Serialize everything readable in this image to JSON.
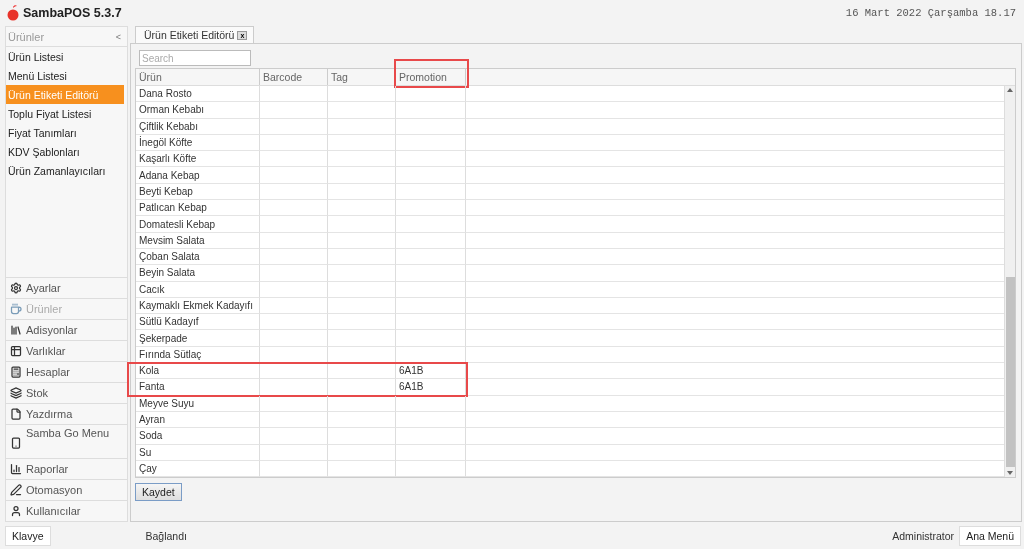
{
  "app": {
    "title": "SambaPOS 5.3.7",
    "datetime": "16 Mart 2022 Çarşamba 18.17"
  },
  "sidebar": {
    "title": "Ürünler",
    "collapse": "<",
    "items": [
      {
        "label": "Ürün Listesi",
        "selected": false
      },
      {
        "label": "Menü Listesi",
        "selected": false
      },
      {
        "label": "Ürün Etiketi Editörü",
        "selected": true
      },
      {
        "label": "Toplu Fiyat Listesi",
        "selected": false
      },
      {
        "label": "Fiyat Tanımları",
        "selected": false
      },
      {
        "label": "KDV Şablonları",
        "selected": false
      },
      {
        "label": "Ürün Zamanlayıcıları",
        "selected": false
      }
    ],
    "nav": [
      {
        "label": "Ayarlar",
        "selected": false
      },
      {
        "label": "Ürünler",
        "selected": true
      },
      {
        "label": "Adisyonlar",
        "selected": false
      },
      {
        "label": "Varlıklar",
        "selected": false
      },
      {
        "label": "Hesaplar",
        "selected": false
      },
      {
        "label": "Stok",
        "selected": false
      },
      {
        "label": "Yazdırma",
        "selected": false
      },
      {
        "label": "Samba Go Menu",
        "selected": false
      },
      {
        "label": "Raporlar",
        "selected": false
      },
      {
        "label": "Otomasyon",
        "selected": false
      },
      {
        "label": "Kullanıcılar",
        "selected": false
      }
    ]
  },
  "tab": {
    "label": "Ürün Etiketi Editörü",
    "close": "x"
  },
  "search": {
    "placeholder": "Search"
  },
  "table": {
    "columns": [
      {
        "label": "Ürün",
        "highlighted": false
      },
      {
        "label": "Barcode",
        "highlighted": false
      },
      {
        "label": "Tag",
        "highlighted": false
      },
      {
        "label": "Promotion",
        "highlighted": true
      }
    ],
    "rows": [
      {
        "name": "Dana Rosto",
        "promotion": "",
        "highlighted": false
      },
      {
        "name": "Orman Kebabı",
        "promotion": "",
        "highlighted": false
      },
      {
        "name": "Çiftlik Kebabı",
        "promotion": "",
        "highlighted": false
      },
      {
        "name": "İnegöl Köfte",
        "promotion": "",
        "highlighted": false
      },
      {
        "name": "Kaşarlı Köfte",
        "promotion": "",
        "highlighted": false
      },
      {
        "name": "Adana Kebap",
        "promotion": "",
        "highlighted": false
      },
      {
        "name": "Beyti Kebap",
        "promotion": "",
        "highlighted": false
      },
      {
        "name": "Patlıcan Kebap",
        "promotion": "",
        "highlighted": false
      },
      {
        "name": "Domatesli Kebap",
        "promotion": "",
        "highlighted": false
      },
      {
        "name": "Mevsim Salata",
        "promotion": "",
        "highlighted": false
      },
      {
        "name": "Çoban Salata",
        "promotion": "",
        "highlighted": false
      },
      {
        "name": "Beyin Salata",
        "promotion": "",
        "highlighted": false
      },
      {
        "name": "Cacık",
        "promotion": "",
        "highlighted": false
      },
      {
        "name": "Kaymaklı Ekmek Kadayıfı",
        "promotion": "",
        "highlighted": false
      },
      {
        "name": "Sütlü Kadayıf",
        "promotion": "",
        "highlighted": false
      },
      {
        "name": "Şekerpade",
        "promotion": "",
        "highlighted": false
      },
      {
        "name": "Fırında Sütlaç",
        "promotion": "",
        "highlighted": false
      },
      {
        "name": "Kola",
        "promotion": "6A1B",
        "highlighted": true
      },
      {
        "name": "Fanta",
        "promotion": "6A1B",
        "highlighted": true
      },
      {
        "name": "Meyve Suyu",
        "promotion": "",
        "highlighted": false
      },
      {
        "name": "Ayran",
        "promotion": "",
        "highlighted": false
      },
      {
        "name": "Soda",
        "promotion": "",
        "highlighted": false
      },
      {
        "name": "Su",
        "promotion": "",
        "highlighted": false
      },
      {
        "name": "Çay",
        "promotion": "",
        "highlighted": false
      }
    ]
  },
  "save_button": "Kaydet",
  "status_bar": {
    "keyboard": "Klavye",
    "connection": "Bağlandı",
    "user": "Administrator",
    "main_menu": "Ana Menü"
  }
}
